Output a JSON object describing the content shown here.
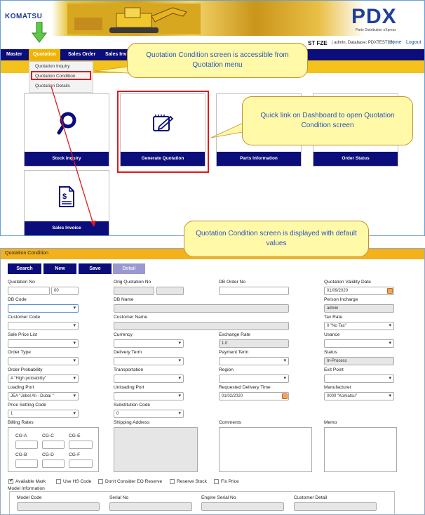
{
  "app": {
    "logo_text": "KOMATSU",
    "product_logo": "PDX",
    "product_sub": "Parts Distribution eXpress",
    "company_fragment": "ST FZE",
    "user_info": "| admin, Database: PDXTEST12 |",
    "home_link": "Home",
    "logout_link": "Logout"
  },
  "menu": {
    "items": [
      "Master",
      "Quotation",
      "Sales Order",
      "Sales Inv"
    ],
    "active": "Quotation"
  },
  "quotation_dropdown": {
    "items": [
      "Quotation Inquiry",
      "Quotation Condition",
      "Quotation Details"
    ],
    "highlighted": "Quotation Condition"
  },
  "dashboard_tiles": [
    {
      "label": "Stock Inquiry",
      "icon": "magnifier-icon"
    },
    {
      "label": "Generate Quotation",
      "icon": "tablet-pen-icon"
    },
    {
      "label": "Parts Information",
      "icon": "none"
    },
    {
      "label": "Order Status",
      "icon": "none"
    },
    {
      "label": "Sales Invoice",
      "icon": "invoice-dollar-icon"
    }
  ],
  "callouts": {
    "menu": "Quotation Condition  screen is accessible from Quotation menu",
    "dashboard": "Quick link on Dashboard to open Quotation Condition screen",
    "form": "Quotation Condition screen is displayed with default values"
  },
  "form": {
    "title": "Quotation Condition",
    "toolbar": {
      "search": "Search",
      "new": "New",
      "save": "Save",
      "detail": "Detail"
    },
    "labels": {
      "quotation_no": "Quotation No",
      "orig_quotation_no": "Orig Quotation No",
      "db_order_no": "DB Order No",
      "quotation_validity_date": "Quotation Validity Date",
      "db_code": "DB Code",
      "db_name": "DB Name",
      "person_incharge": "Person Incharge",
      "customer_code": "Customer Code",
      "customer_name": "Customer Name",
      "tax_rate": "Tax Rate",
      "sale_price_list": "Sale Price List",
      "currency": "Currency",
      "exchange_rate": "Exchange Rate",
      "usance": "Usance",
      "order_type": "Order Type",
      "delivery_term": "Delivery Term",
      "payment_term": "Payment Term",
      "status": "Status",
      "order_probability": "Order Probability",
      "transportation": "Transportation",
      "region": "Region",
      "exit_point": "Exit Point",
      "loading_port": "Loading Port",
      "unloading_port": "Unloading Port",
      "requested_delivery_time": "Requested Delivery Time",
      "manufacturer": "Manufacturer",
      "price_setting_code": "Price Setting Code",
      "substitution_code": "Substitution Code",
      "billing_rates": "Billing Rates",
      "shipping_address": "Shipping Address",
      "comments": "Comments",
      "memo": "Memo",
      "model_information": "Model Information"
    },
    "values": {
      "quotation_suffix": "00",
      "quotation_validity_date": "01/09/2020",
      "person_incharge": "admin",
      "tax_rate": "0 \"No Tax\"",
      "exchange_rate": "1.0",
      "status": "In-Process",
      "order_probability": "A \"High probability\"",
      "loading_port": "JEA \"Jebel Ali - Dubai \"",
      "requested_delivery_time": "01/02/2020",
      "manufacturer": "0000 \"Komatsu\"",
      "price_setting_code": "1",
      "substitution_code": "0"
    },
    "billing_codes": [
      "CG-A",
      "CG-C",
      "CG-E",
      "CG-B",
      "CG-D",
      "CG-F"
    ],
    "checkboxes": [
      {
        "label": "Available Mark",
        "checked": true
      },
      {
        "label": "Use HS Code",
        "checked": false
      },
      {
        "label": "Don't Consider EO Reserve",
        "checked": false
      },
      {
        "label": "Reserve Stock",
        "checked": false
      },
      {
        "label": "Fix Price",
        "checked": false
      }
    ],
    "model_columns": [
      "Model Code",
      "Serial No",
      "Engine Serial No",
      "Customer Detail"
    ]
  },
  "colors": {
    "navy": "#0b0d7a",
    "gold": "#f3b21b",
    "highlight_red": "#e0191e",
    "callout_fill": "#fff9a8",
    "callout_text": "#2a55c0"
  }
}
